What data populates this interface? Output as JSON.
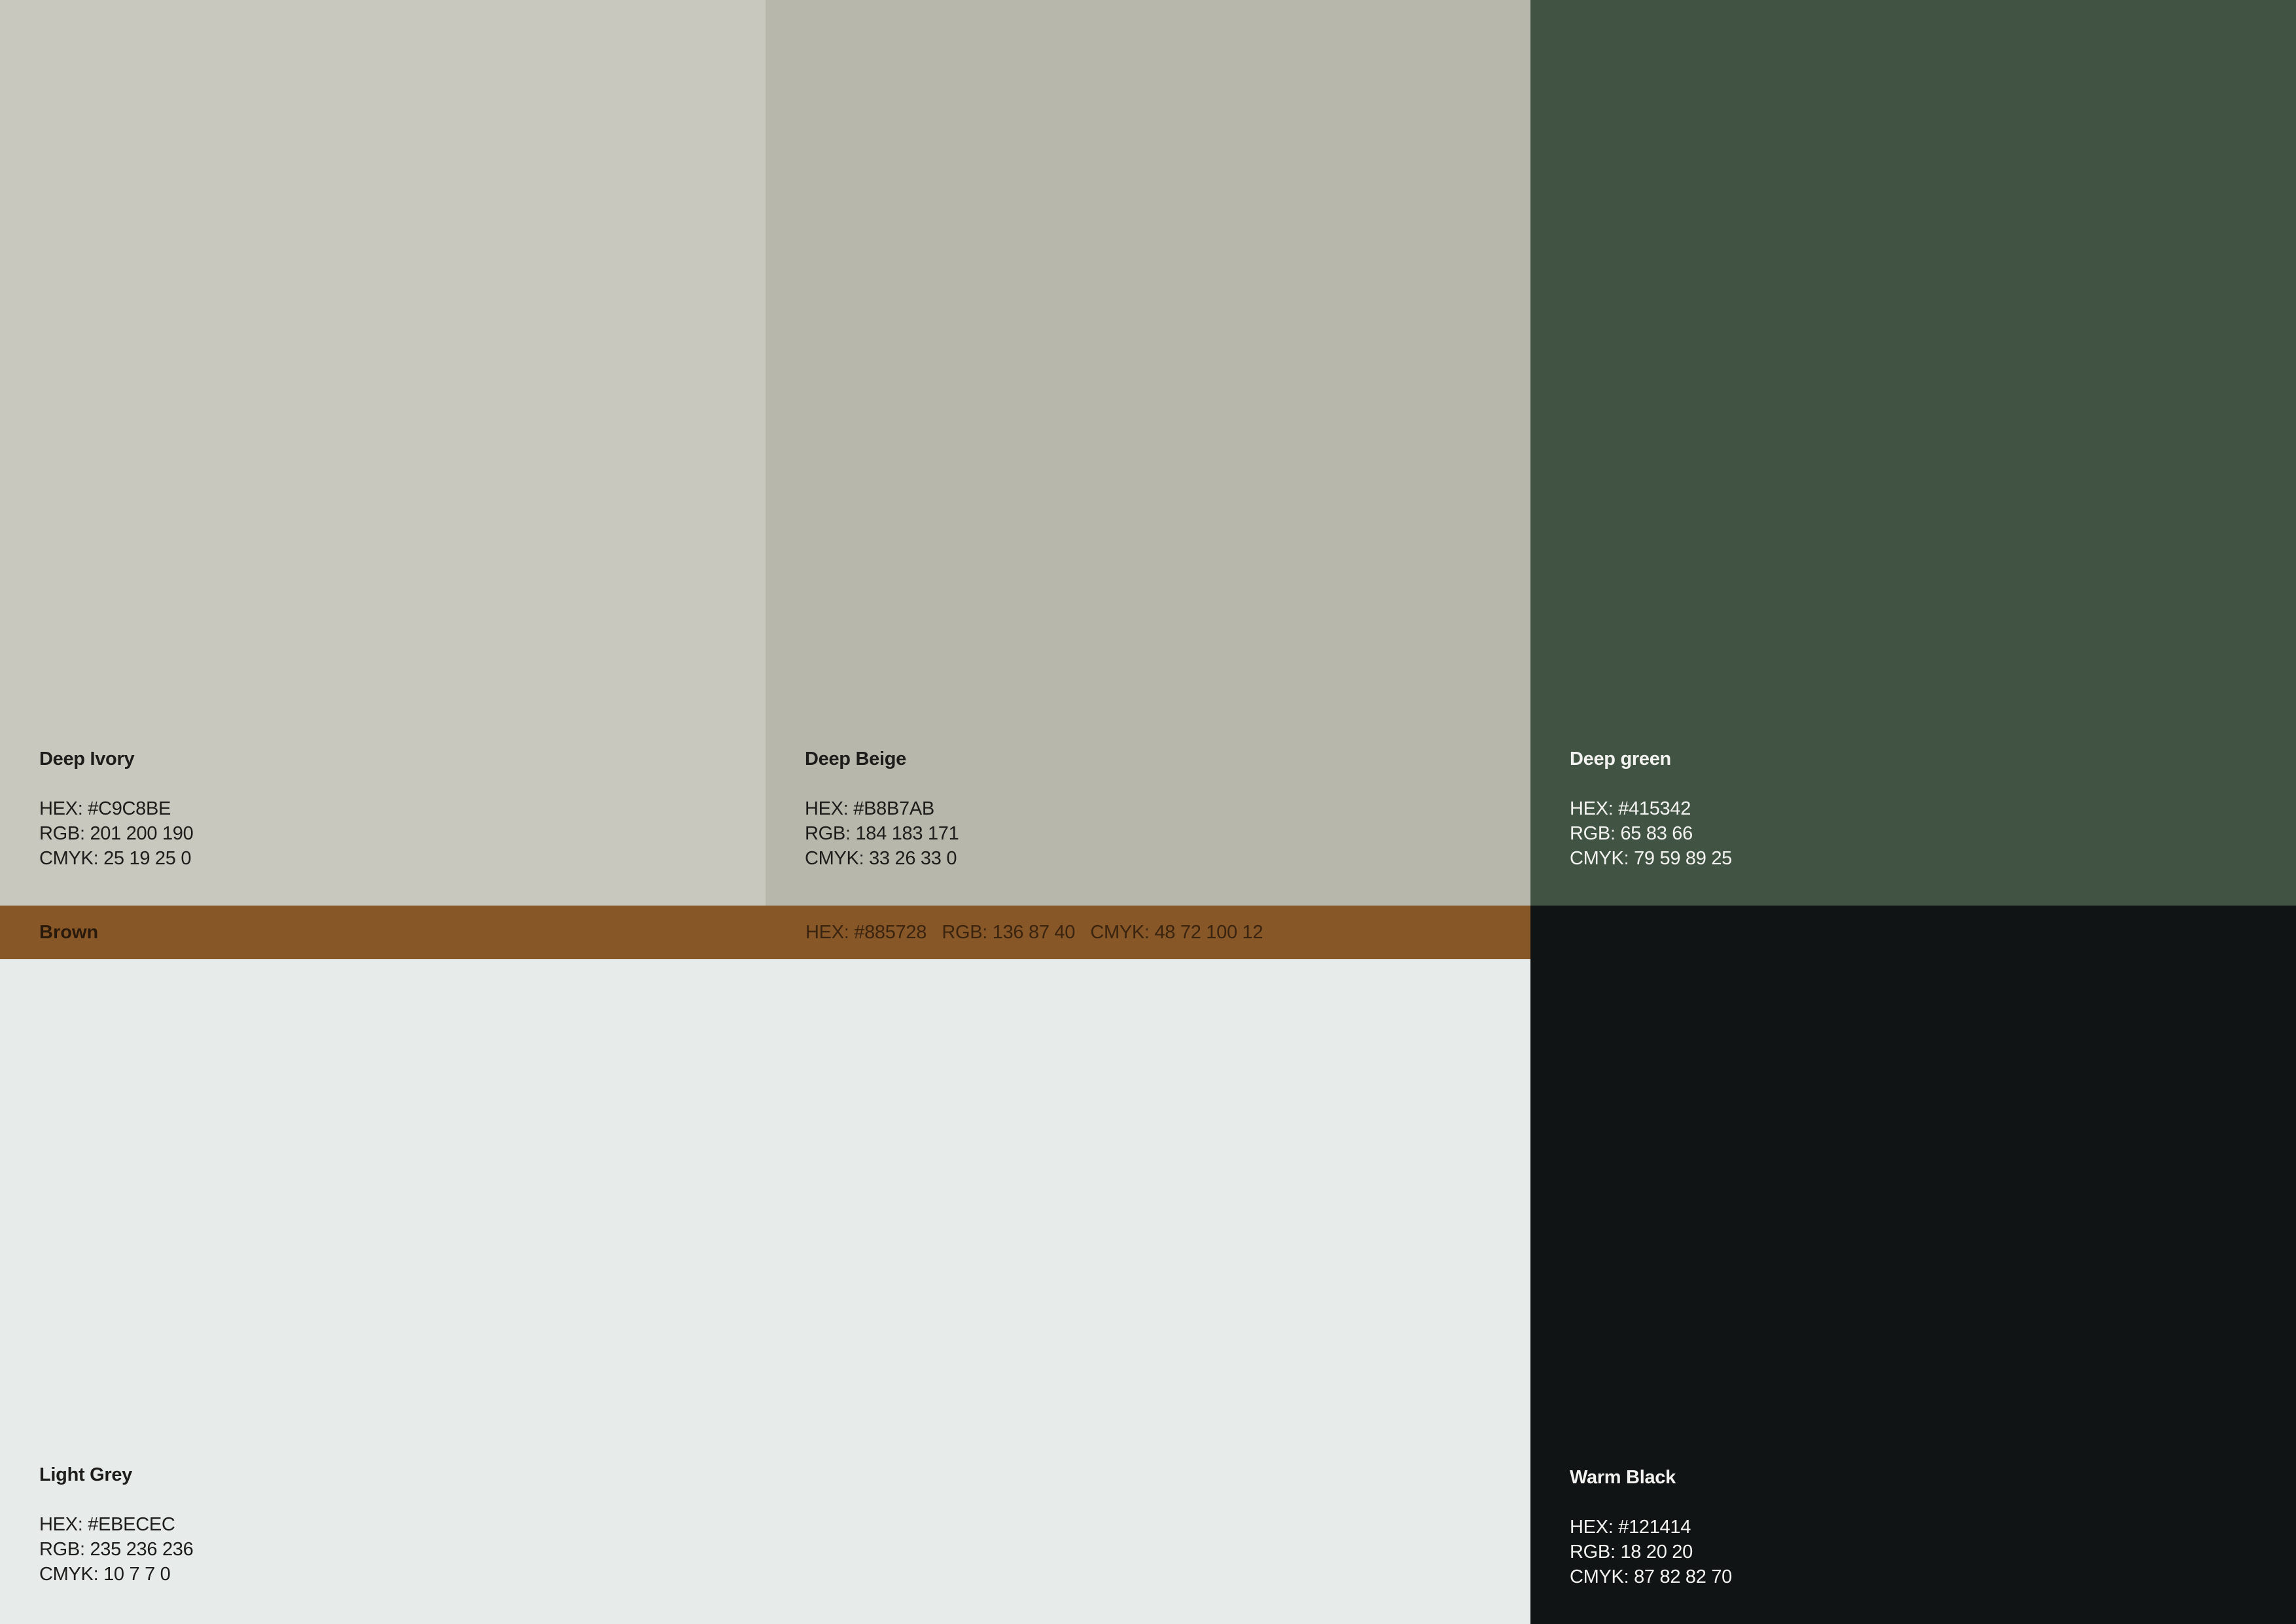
{
  "swatches": {
    "deep_ivory": {
      "name": "Deep Ivory",
      "hex": "HEX: #C9C8BE",
      "rgb": "RGB: 201 200 190",
      "cmyk": "CMYK: 25 19 25 0",
      "color": "#C9C8BE"
    },
    "deep_beige": {
      "name": "Deep Beige",
      "hex": "HEX: #B8B7AB",
      "rgb": "RGB: 184 183 171",
      "cmyk": "CMYK: 33 26 33 0",
      "color": "#B8B7AB"
    },
    "deep_green": {
      "name": "Deep green",
      "hex": "HEX: #415342",
      "rgb": "RGB: 65 83 66",
      "cmyk": "CMYK: 79 59 89 25",
      "color": "#415342"
    },
    "brown": {
      "name": "Brown",
      "spec": "HEX: #885728   RGB: 136 87 40   CMYK: 48 72 100 12",
      "color": "#885728"
    },
    "light_grey": {
      "name": "Light Grey",
      "hex": "HEX: #EBECEC",
      "rgb": "RGB: 235 236 236",
      "cmyk": "CMYK: 10 7 7 0",
      "color": "#E7EBEA"
    },
    "warm_black": {
      "name": "Warm Black",
      "hex": "HEX: #121414",
      "rgb": "RGB: 18 20 20",
      "cmyk": "CMYK: 87 82 82 70",
      "color": "#111414"
    }
  }
}
